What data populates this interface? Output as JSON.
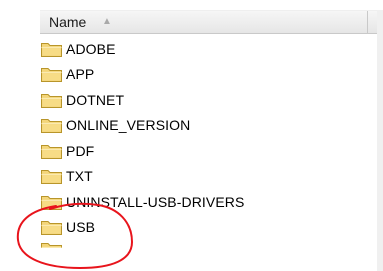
{
  "header": {
    "name_label": "Name",
    "sort_icon": "sort-ascending-icon"
  },
  "folders": [
    {
      "label": "ADOBE"
    },
    {
      "label": "APP"
    },
    {
      "label": "DOTNET"
    },
    {
      "label": "ONLINE_VERSION"
    },
    {
      "label": "PDF"
    },
    {
      "label": "TXT"
    },
    {
      "label": "UNINSTALL-USB-DRIVERS"
    },
    {
      "label": "USB"
    }
  ],
  "colors": {
    "folder_fill": "#f3d57a",
    "folder_edge": "#b8952a",
    "annotation": "#e8141c"
  }
}
